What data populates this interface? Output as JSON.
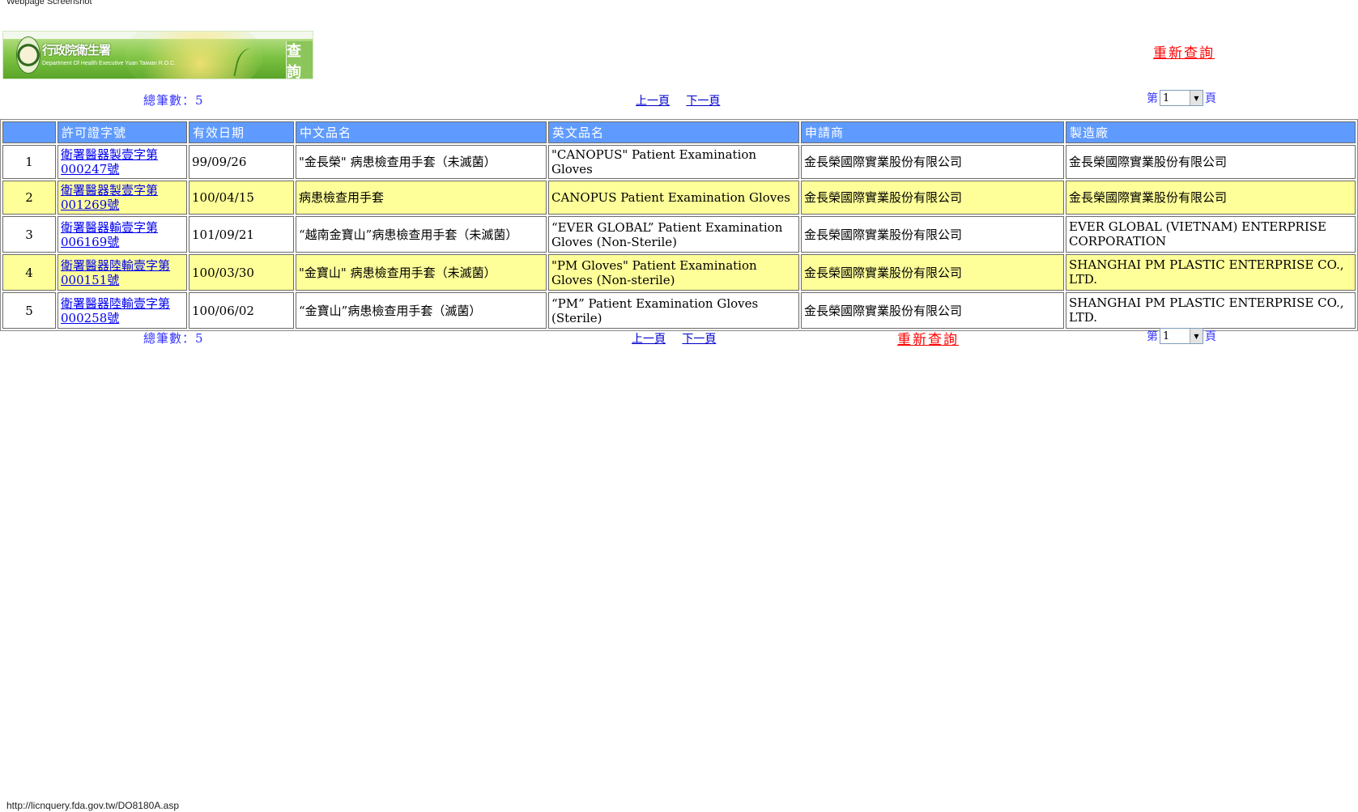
{
  "caption": "Webpage Screenshot",
  "footer_url": "http://licnquery.fda.gov.tw/DO8180A.asp",
  "banner": {
    "org_cn": "行政院衛生署",
    "org_en": "Department Of Health Executive Yuan Taiwan R.O.C.",
    "tab_label": "查詢"
  },
  "requery_label": "重新查詢",
  "summary": {
    "total_label": "總筆數：5",
    "prev_label": "上一頁",
    "next_label": "下一頁",
    "page_prefix": "第",
    "page_value": "1",
    "page_suffix": "頁"
  },
  "table": {
    "headers": [
      "",
      "許可證字號",
      "有效日期",
      "中文品名",
      "英文品名",
      "申請商",
      "製造廠"
    ],
    "rows": [
      {
        "no": "1",
        "license": "衛署醫器製壹字第000247號",
        "date": "99/09/26",
        "cn_name": "\"金長榮\" 病患檢查用手套（未滅菌）",
        "en_name": "\"CANOPUS\" Patient Examination Gloves",
        "applicant": "金長榮國際實業股份有限公司",
        "maker": "金長榮國際實業股份有限公司"
      },
      {
        "no": "2",
        "license": "衛署醫器製壹字第001269號",
        "date": "100/04/15",
        "cn_name": "病患檢查用手套",
        "en_name": "CANOPUS Patient Examination Gloves",
        "applicant": "金長榮國際實業股份有限公司",
        "maker": "金長榮國際實業股份有限公司"
      },
      {
        "no": "3",
        "license": "衛署醫器輸壹字第006169號",
        "date": "101/09/21",
        "cn_name": "“越南金寶山”病患檢查用手套（未滅菌）",
        "en_name": "“EVER GLOBAL” Patient Examination Gloves (Non-Sterile)",
        "applicant": "金長榮國際實業股份有限公司",
        "maker": "EVER GLOBAL (VIETNAM) ENTERPRISE CORPORATION"
      },
      {
        "no": "4",
        "license": "衛署醫器陸輸壹字第000151號",
        "date": "100/03/30",
        "cn_name": "\"金寶山\" 病患檢查用手套（未滅菌）",
        "en_name": "\"PM Gloves\" Patient Examination Gloves (Non-sterile)",
        "applicant": "金長榮國際實業股份有限公司",
        "maker": "SHANGHAI PM PLASTIC ENTERPRISE CO., LTD."
      },
      {
        "no": "5",
        "license": "衛署醫器陸輸壹字第000258號",
        "date": "100/06/02",
        "cn_name": "“金寶山”病患檢查用手套（滅菌）",
        "en_name": "“PM” Patient Examination Gloves (Sterile)",
        "applicant": "金長榮國際實業股份有限公司",
        "maker": "SHANGHAI PM PLASTIC ENTERPRISE CO., LTD."
      }
    ]
  },
  "colors": {
    "header_bg": "#5f9bff",
    "row_alt_bg": "#ffff99",
    "requery_red": "#ff0000",
    "count_blue": "#3333ff"
  }
}
